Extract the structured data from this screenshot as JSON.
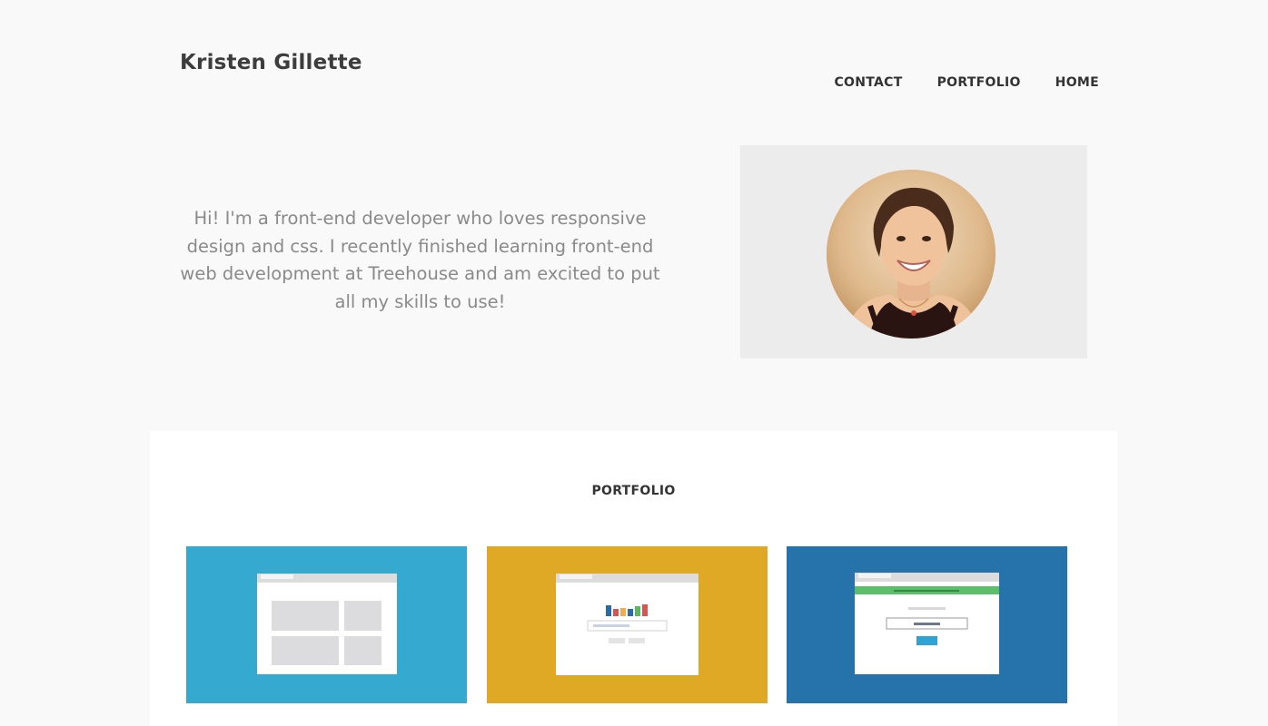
{
  "header": {
    "site_title": "Kristen Gillette",
    "nav": [
      "CONTACT",
      "PORTFOLIO",
      "HOME"
    ]
  },
  "intro": {
    "text": "Hi! I'm a front-end developer who loves responsive design and css. I recently finished learning front-end web development at Treehouse and am excited to put all my skills to use!"
  },
  "profile_photo": {
    "icon": "profile-photo"
  },
  "portfolio": {
    "heading": "PORTFOLIO",
    "tiles": [
      {
        "icon": "layout-grid-screenshot",
        "bg": "#36a9d0"
      },
      {
        "icon": "bar-chart-search-screenshot",
        "bg": "#e0a925"
      },
      {
        "icon": "signup-form-screenshot",
        "bg": "#2673ab"
      }
    ]
  },
  "colors": {
    "page_bg": "#f9f9f9",
    "text": "#444444",
    "intro_text": "#8a8a8a"
  }
}
